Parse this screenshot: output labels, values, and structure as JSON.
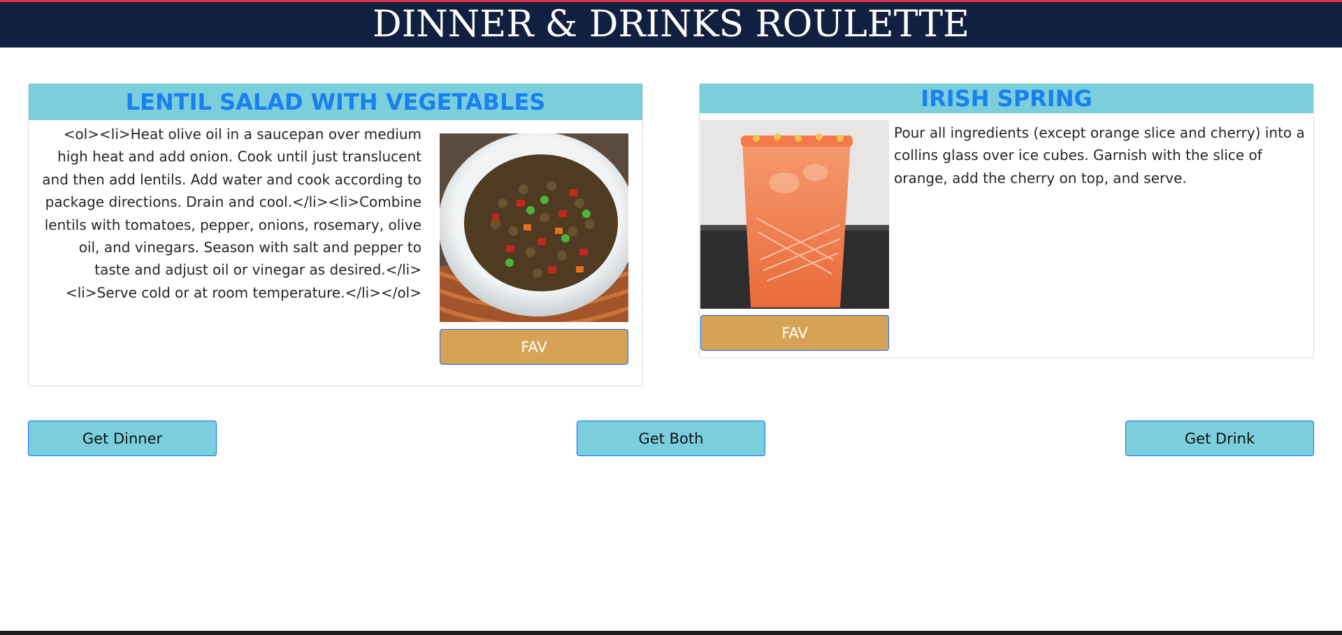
{
  "header": {
    "title": "DINNER & DRINKS ROULETTE"
  },
  "dinner": {
    "title": "LENTIL SALAD WITH VEGETABLES",
    "instructions": "<ol><li>Heat olive oil in a saucepan over medium high heat and add onion. Cook until just translucent and then add lentils. Add water and cook according to package directions. Drain and cool.</li><li>Combine lentils with tomatoes, pepper, onions, rosemary, olive oil, and vinegars. Season with salt and pepper to taste and adjust oil or vinegar as desired.</li><li>Serve cold or at room temperature.</li></ol>",
    "fav_label": "FAV"
  },
  "drink": {
    "title": "IRISH SPRING",
    "instructions": "Pour all ingredients (except orange slice and cherry) into a collins glass over ice cubes. Garnish with the slice of orange, add the cherry on top, and serve.",
    "fav_label": "FAV"
  },
  "actions": {
    "get_dinner": "Get Dinner",
    "get_both": "Get Both",
    "get_drink": "Get Drink"
  },
  "colors": {
    "header_bg": "#112040",
    "card_title_bg": "#7bcfdd",
    "card_title_text": "#1a7ff0",
    "fav_bg": "#d6a356",
    "action_bg": "#7bcfdd",
    "button_border": "#0d6efd"
  }
}
